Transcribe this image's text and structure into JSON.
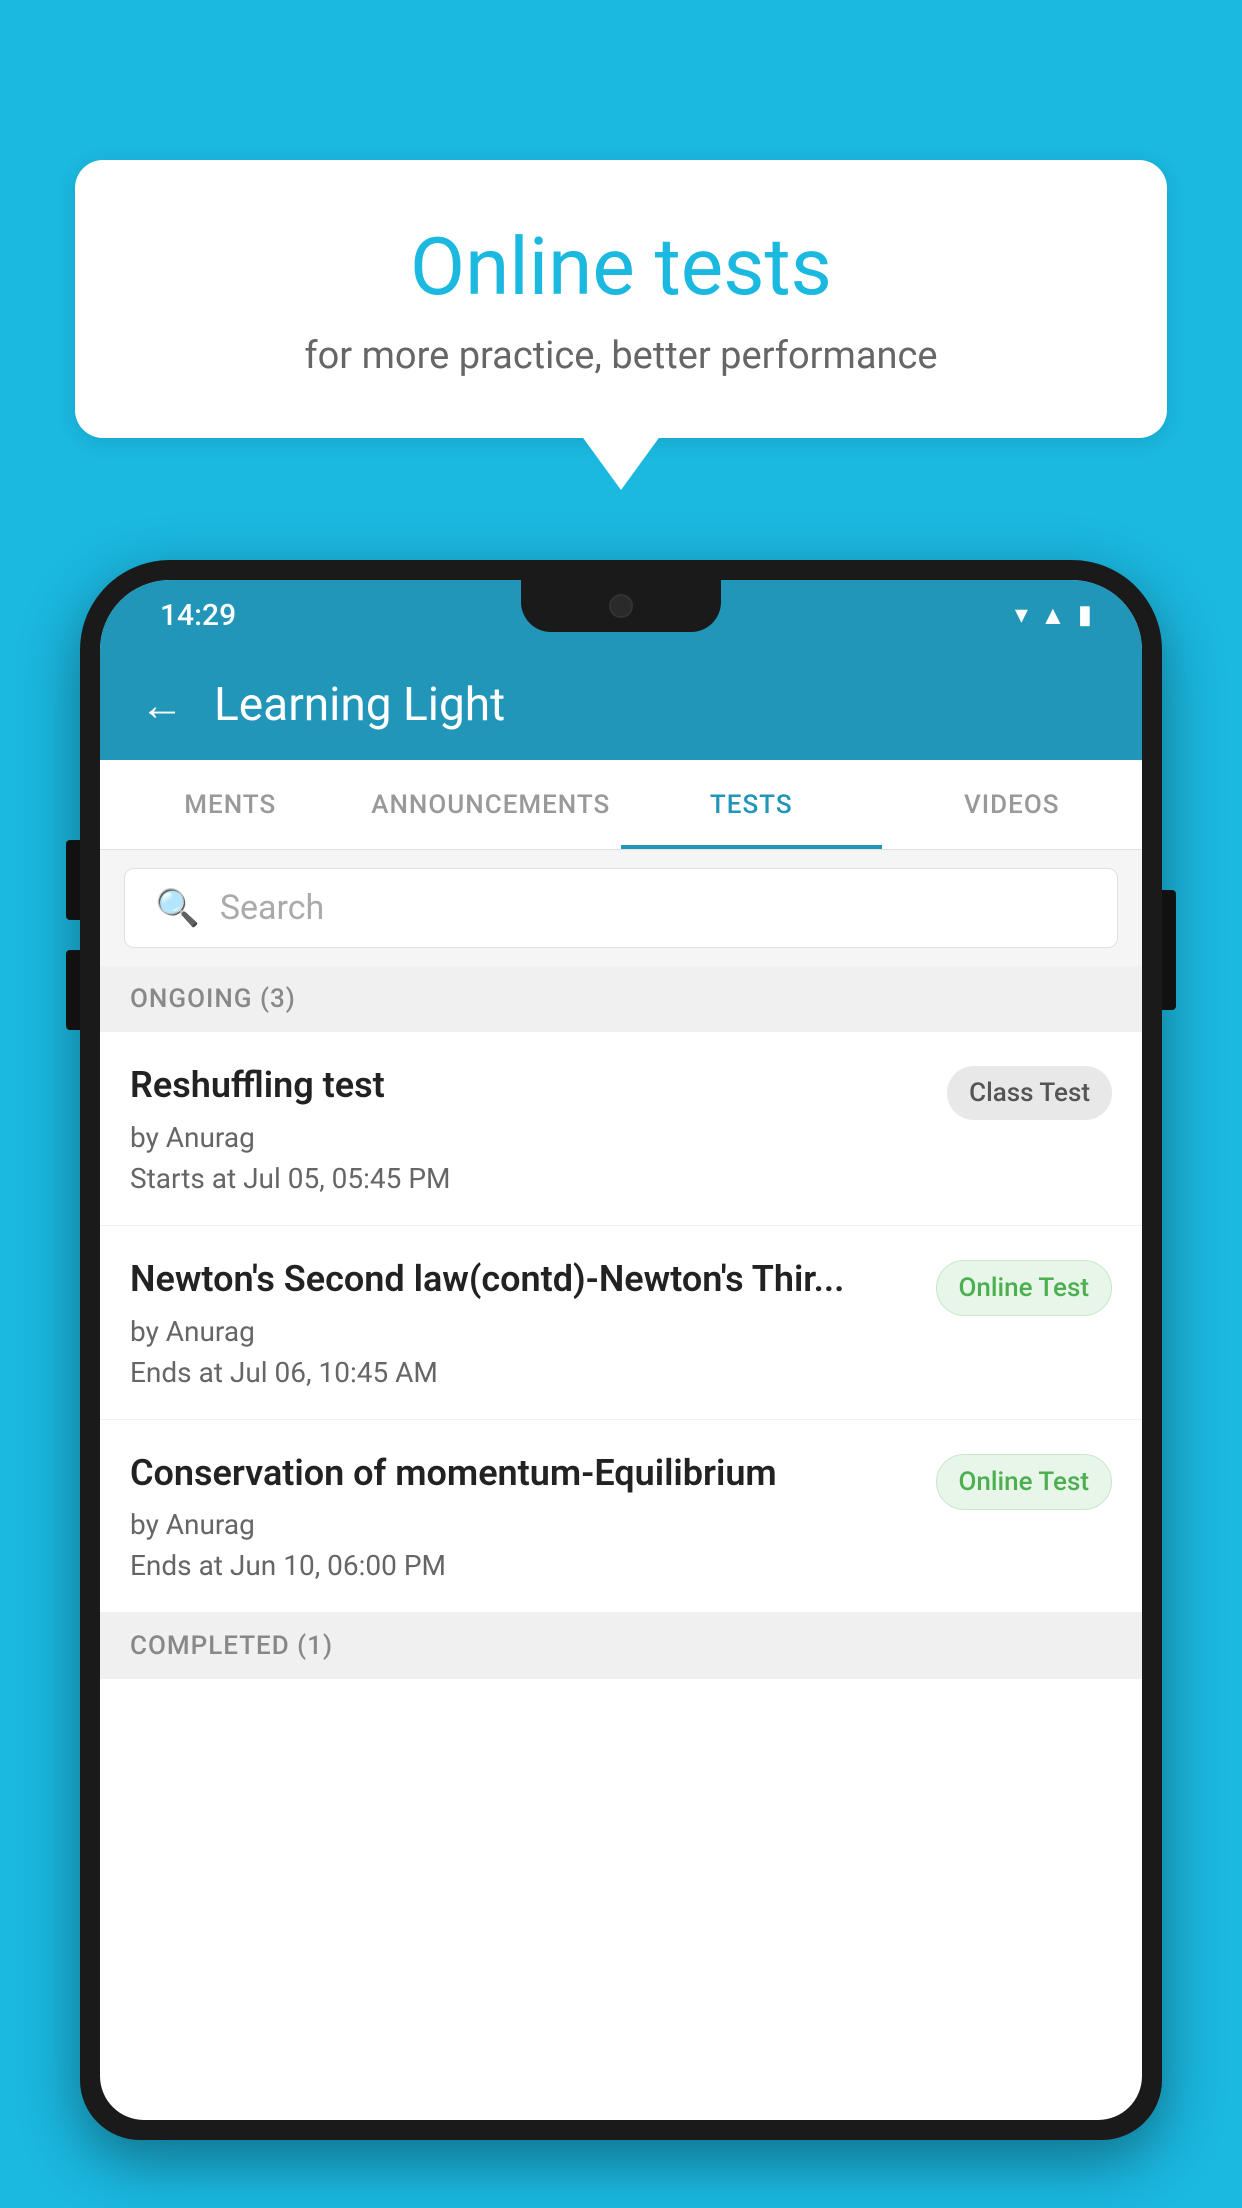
{
  "background_color": "#1BB8E0",
  "bubble": {
    "title": "Online tests",
    "subtitle": "for more practice, better performance"
  },
  "phone": {
    "status_bar": {
      "time": "14:29"
    },
    "app_bar": {
      "title": "Learning Light",
      "back_label": "←"
    },
    "tabs": [
      {
        "label": "MENTS",
        "active": false
      },
      {
        "label": "ANNOUNCEMENTS",
        "active": false
      },
      {
        "label": "TESTS",
        "active": true
      },
      {
        "label": "VIDEOS",
        "active": false
      }
    ],
    "search": {
      "placeholder": "Search"
    },
    "sections": [
      {
        "header": "ONGOING (3)",
        "tests": [
          {
            "name": "Reshuffling test",
            "author": "by Anurag",
            "time_label": "Starts at",
            "time": "Jul 05, 05:45 PM",
            "badge": "Class Test",
            "badge_type": "class"
          },
          {
            "name": "Newton's Second law(contd)-Newton's Thir...",
            "author": "by Anurag",
            "time_label": "Ends at",
            "time": "Jul 06, 10:45 AM",
            "badge": "Online Test",
            "badge_type": "online"
          },
          {
            "name": "Conservation of momentum-Equilibrium",
            "author": "by Anurag",
            "time_label": "Ends at",
            "time": "Jun 10, 06:00 PM",
            "badge": "Online Test",
            "badge_type": "online"
          }
        ]
      }
    ],
    "completed_section_header": "COMPLETED (1)"
  }
}
